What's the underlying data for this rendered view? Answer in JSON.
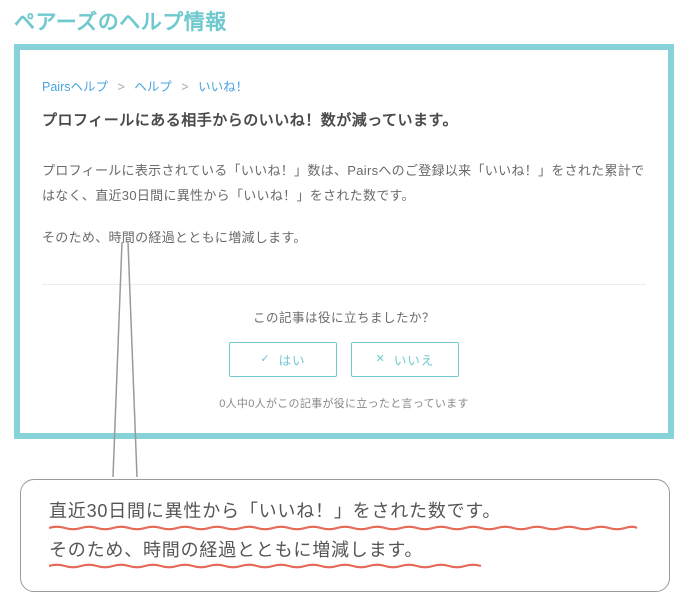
{
  "page_title": "ペアーズのヘルプ情報",
  "breadcrumb": {
    "items": [
      {
        "label": "Pairsヘルプ"
      },
      {
        "label": "ヘルプ"
      },
      {
        "label": "いいね！"
      }
    ],
    "separator": ">"
  },
  "article": {
    "title": "プロフィールにある相手からのいいね！数が減っています。",
    "paragraphs": [
      "プロフィールに表示されている「いいね！」数は、Pairsへのご登録以来「いいね！」をされた累計ではなく、直近30日間に異性から「いいね！」をされた数です。",
      "そのため、時間の経過とともに増減します。"
    ]
  },
  "feedback": {
    "question": "この記事は役に立ちましたか？",
    "yes_label": "はい",
    "no_label": "いいえ",
    "count_text": "0人中0人がこの記事が役に立ったと言っています"
  },
  "callout": {
    "line1": "直近30日間に異性から「いいね！」をされた数です。",
    "line2": "そのため、時間の経過とともに増減します。"
  },
  "colors": {
    "accent": "#6FC9CE",
    "border": "#86D4D9",
    "link": "#4AA3E0",
    "underline": "#E56A5A"
  }
}
